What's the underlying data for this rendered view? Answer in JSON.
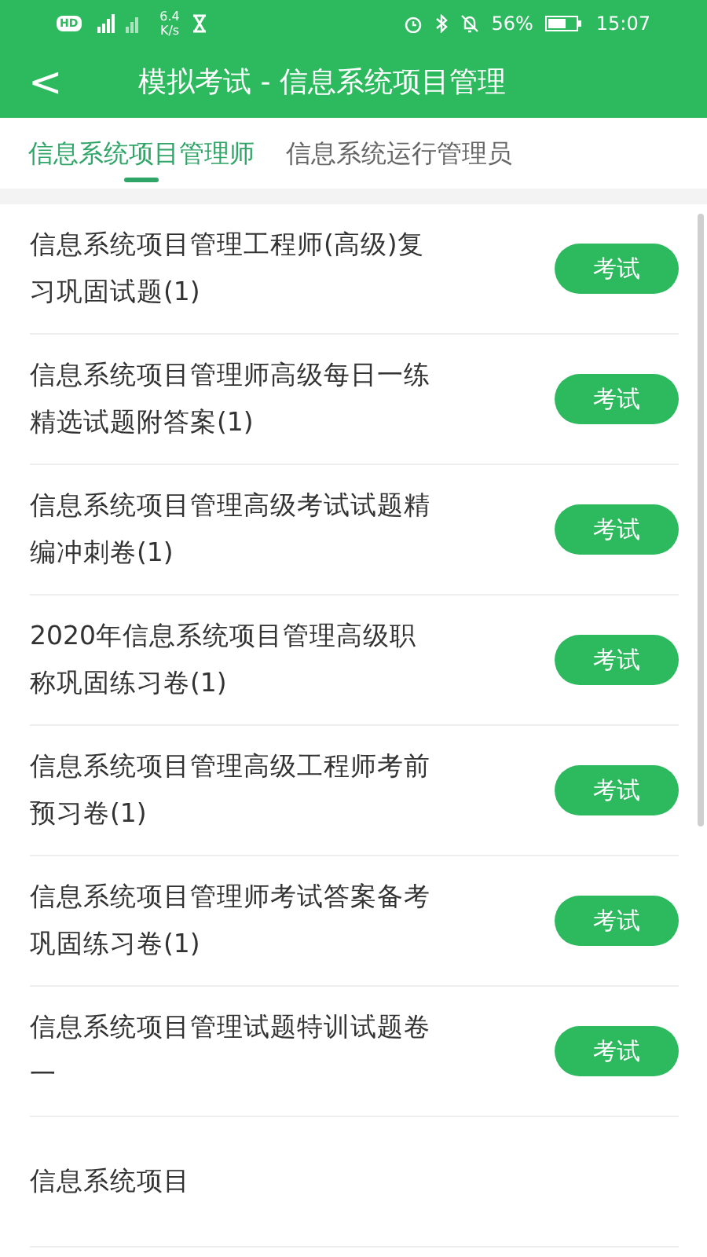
{
  "status_bar": {
    "hd": "HD",
    "speed_value": "6.4",
    "speed_unit": "K/s",
    "battery": "56%",
    "time": "15:07"
  },
  "header": {
    "back": "<",
    "title": "模拟考试 - 信息系统项目管理"
  },
  "tabs": [
    {
      "label": "信息系统项目管理师",
      "selected": true
    },
    {
      "label": "信息系统运行管理员",
      "selected": false
    }
  ],
  "items": [
    {
      "title": "信息系统项目管理工程师(高级)复习巩固试题(1)",
      "button": "考试"
    },
    {
      "title": "信息系统项目管理师高级每日一练精选试题附答案(1)",
      "button": "考试"
    },
    {
      "title": "信息系统项目管理高级考试试题精编冲刺卷(1)",
      "button": "考试"
    },
    {
      "title": "2020年信息系统项目管理高级职称巩固练习卷(1)",
      "button": "考试"
    },
    {
      "title": "信息系统项目管理高级工程师考前预习卷(1)",
      "button": "考试"
    },
    {
      "title": "信息系统项目管理师考试答案备考巩固练习卷(1)",
      "button": "考试"
    },
    {
      "title": "信息系统项目管理试题特训试题卷一",
      "button": "考试"
    },
    {
      "title": "信息系统项目"
    }
  ]
}
